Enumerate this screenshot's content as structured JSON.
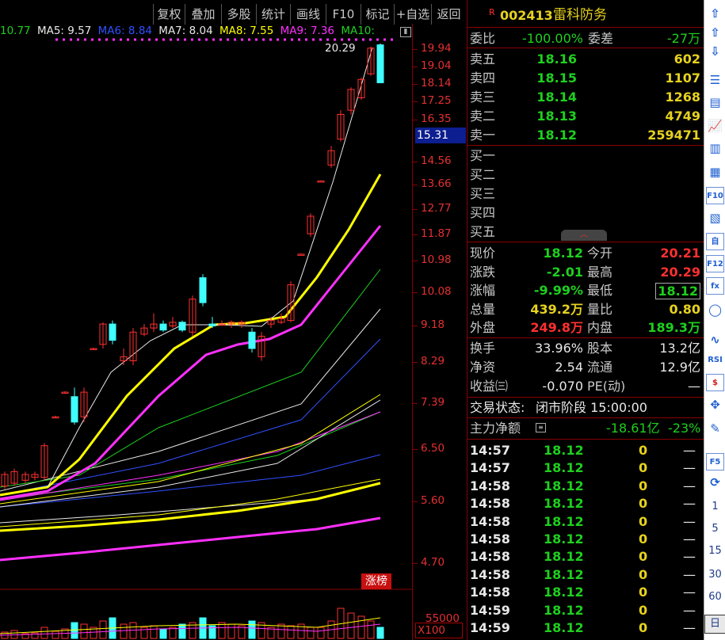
{
  "toolbar": {
    "buttons": [
      "复权",
      "叠加",
      "多股",
      "统计",
      "画线",
      "F10",
      "标记",
      "+自选",
      "返回"
    ]
  },
  "ma_legend": [
    {
      "text": "10.77",
      "color": "#1ed01e"
    },
    {
      "text": "MA5: 9.57",
      "color": "#e8e8e8"
    },
    {
      "text": "MA6: 8.84",
      "color": "#3050ff"
    },
    {
      "text": "MA7: 8.04",
      "color": "#e8e8e8"
    },
    {
      "text": "MA8: 7.55",
      "color": "#ffff00"
    },
    {
      "text": "MA9: 7.36",
      "color": "#ff30ff"
    },
    {
      "text": "MA10: ",
      "color": "#1ed01e"
    }
  ],
  "price_axis": [
    "19.94",
    "19.04",
    "18.14",
    "17.25",
    "16.35",
    "14.56",
    "13.66",
    "12.77",
    "11.87",
    "10.98",
    "10.08",
    "9.18",
    "8.29",
    "7.39",
    "6.50",
    "5.60",
    "4.70"
  ],
  "current_price_label": "15.31",
  "high_annotation": "20.29",
  "zhangbang": "涨榜",
  "volume": {
    "label": "55000",
    "multiplier": "X100"
  },
  "header": {
    "badge": "R",
    "code": "002413",
    "name": "雷科防务"
  },
  "weibi": {
    "label1": "委比",
    "value1": "-100.00%",
    "label2": "委差",
    "value2": "-27万"
  },
  "asks": [
    {
      "label": "卖五",
      "price": "18.16",
      "vol": "602"
    },
    {
      "label": "卖四",
      "price": "18.15",
      "vol": "1107"
    },
    {
      "label": "卖三",
      "price": "18.14",
      "vol": "1268"
    },
    {
      "label": "卖二",
      "price": "18.13",
      "vol": "4749"
    },
    {
      "label": "卖一",
      "price": "18.12",
      "vol": "259471"
    }
  ],
  "bids": [
    "买一",
    "买二",
    "买三",
    "买四",
    "买五"
  ],
  "quote": [
    {
      "l1": "现价",
      "v1": "18.12",
      "c1": "grn",
      "l2": "今开",
      "v2": "20.21",
      "c2": "red"
    },
    {
      "l1": "涨跌",
      "v1": "-2.01",
      "c1": "grn",
      "l2": "最高",
      "v2": "20.29",
      "c2": "red"
    },
    {
      "l1": "涨幅",
      "v1": "-9.99%",
      "c1": "grn",
      "l2": "最低",
      "v2": "18.12",
      "c2": "grn"
    },
    {
      "l1": "总量",
      "v1": "439.2万",
      "c1": "yel",
      "l2": "量比",
      "v2": "0.80",
      "c2": "yel"
    },
    {
      "l1": "外盘",
      "v1": "249.8万",
      "c1": "red",
      "l2": "内盘",
      "v2": "189.3万",
      "c2": "grn"
    }
  ],
  "stats": [
    {
      "l1": "换手",
      "v1": "33.96%",
      "l2": "股本",
      "v2": "13.2亿"
    },
    {
      "l1": "净资",
      "v1": "2.54",
      "l2": "流通",
      "v2": "12.9亿"
    },
    {
      "l1": "收益㈢",
      "v1": "-0.070",
      "l2": "PE(动)",
      "v2": "—"
    }
  ],
  "trade_status": {
    "label": "交易状态:",
    "value": "闭市阶段 15:00:00"
  },
  "main_flow": {
    "label": "主力净额",
    "value": "-18.61亿",
    "pct": "-23%"
  },
  "ticks": [
    {
      "time": "14:57",
      "price": "18.12",
      "vol": "0",
      "dir": "—"
    },
    {
      "time": "14:57",
      "price": "18.12",
      "vol": "0",
      "dir": "—"
    },
    {
      "time": "14:58",
      "price": "18.12",
      "vol": "0",
      "dir": "—"
    },
    {
      "time": "14:58",
      "price": "18.12",
      "vol": "0",
      "dir": "—"
    },
    {
      "time": "14:58",
      "price": "18.12",
      "vol": "0",
      "dir": "—"
    },
    {
      "time": "14:58",
      "price": "18.12",
      "vol": "0",
      "dir": "—"
    },
    {
      "time": "14:58",
      "price": "18.12",
      "vol": "0",
      "dir": "—"
    },
    {
      "time": "14:58",
      "price": "18.12",
      "vol": "0",
      "dir": "—"
    },
    {
      "time": "14:58",
      "price": "18.12",
      "vol": "0",
      "dir": "—"
    },
    {
      "time": "14:59",
      "price": "18.12",
      "vol": "0",
      "dir": "—"
    },
    {
      "time": "14:59",
      "price": "18.12",
      "vol": "0",
      "dir": "—"
    }
  ],
  "right_bar": {
    "icons": [
      "up-arrow-icon",
      "up-arrow-icon",
      "down-arrow-icon",
      "list-icon",
      "table-icon",
      "line-chart-icon",
      "candle-icon",
      "book-icon",
      "f10-icon",
      "note-icon",
      "self-icon",
      "f12-icon",
      "formula-icon",
      "circle-icon",
      "wave-icon",
      "rsi-icon",
      "dollar-icon",
      "move-icon",
      "pen-icon",
      "f5-icon",
      "refresh-icon"
    ],
    "labels": {
      "f10": "F10",
      "self": "自",
      "f12": "F12",
      "rsi": "RSI",
      "f5": "F5",
      "dollar": "$",
      "formula": "fx"
    },
    "periods": [
      "1",
      "5",
      "15",
      "30",
      "60",
      "日"
    ]
  },
  "colors": {
    "up": "#ff3030",
    "down": "#40ffff",
    "ma5": "#e8e8e8",
    "ma8": "#ffff00",
    "ma9": "#ff30ff",
    "grid_red": "#8a0000"
  }
}
